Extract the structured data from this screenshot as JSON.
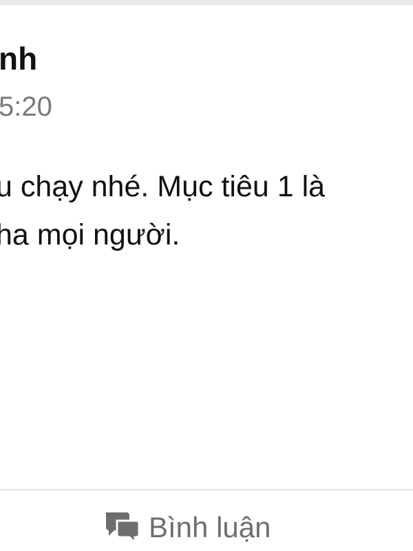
{
  "post": {
    "author_name_partial": "nh",
    "time_partial": "5:20",
    "body_line_1": "u chạy nhé. Mục tiêu 1 là",
    "body_line_2": "ha mọi người."
  },
  "actions": {
    "comment_label": "Bình luận",
    "comment_icon": "comment-bubbles-icon"
  },
  "colors": {
    "text_primary": "#111111",
    "text_secondary": "#7a7a7a",
    "action_gray": "#6e6e6e",
    "divider": "#e4e4e4",
    "top_strip": "#e9e9e9"
  }
}
